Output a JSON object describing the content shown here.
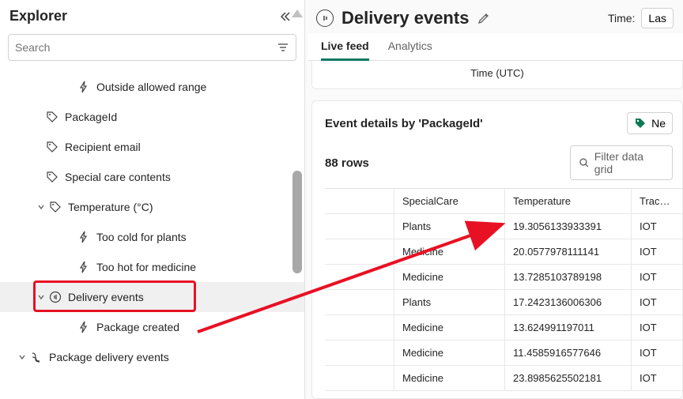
{
  "explorer": {
    "title": "Explorer",
    "search_placeholder": "Search",
    "items": [
      {
        "icon": "lightning",
        "label": "Outside allowed range",
        "lvl": 2
      },
      {
        "icon": "tag",
        "label": "PackageId",
        "lvl": 1
      },
      {
        "icon": "tag",
        "label": "Recipient email",
        "lvl": 1
      },
      {
        "icon": "tag",
        "label": "Special care contents",
        "lvl": 1
      },
      {
        "icon": "tag",
        "label": "Temperature (°C)",
        "lvl": 1,
        "chev": "down"
      },
      {
        "icon": "lightning",
        "label": "Too cold for plants",
        "lvl": 2
      },
      {
        "icon": "lightning",
        "label": "Too hot for medicine",
        "lvl": 2
      },
      {
        "icon": "stream",
        "label": "Delivery events",
        "lvl": 1,
        "chev": "down",
        "selected": true,
        "highlighted": true
      },
      {
        "icon": "lightning",
        "label": "Package created",
        "lvl": 2
      },
      {
        "icon": "flow",
        "label": "Package delivery events",
        "lvl": 0,
        "chev": "down"
      }
    ]
  },
  "header": {
    "title": "Delivery events",
    "time_label": "Time:",
    "time_value": "Las"
  },
  "tabs": [
    {
      "label": "Live feed",
      "active": true
    },
    {
      "label": "Analytics",
      "active": false
    }
  ],
  "time_axis_label": "Time (UTC)",
  "details": {
    "title": "Event details by 'PackageId'",
    "new_label": "Ne",
    "row_count": "88 rows",
    "filter_placeholder": "Filter data grid",
    "columns": [
      "",
      "SpecialCare",
      "Temperature",
      "Tracking"
    ],
    "rows": [
      {
        "special": "Plants",
        "temp": "19.3056133933391",
        "track": "IOT"
      },
      {
        "special": "Medicine",
        "temp": "20.0577978111141",
        "track": "IOT"
      },
      {
        "special": "Medicine",
        "temp": "13.7285103789198",
        "track": "IOT"
      },
      {
        "special": "Plants",
        "temp": "17.2423136006306",
        "track": "IOT"
      },
      {
        "special": "Medicine",
        "temp": "13.624991197011",
        "track": "IOT"
      },
      {
        "special": "Medicine",
        "temp": "11.4585916577646",
        "track": "IOT"
      },
      {
        "special": "Medicine",
        "temp": "23.8985625502181",
        "track": "IOT"
      }
    ]
  }
}
